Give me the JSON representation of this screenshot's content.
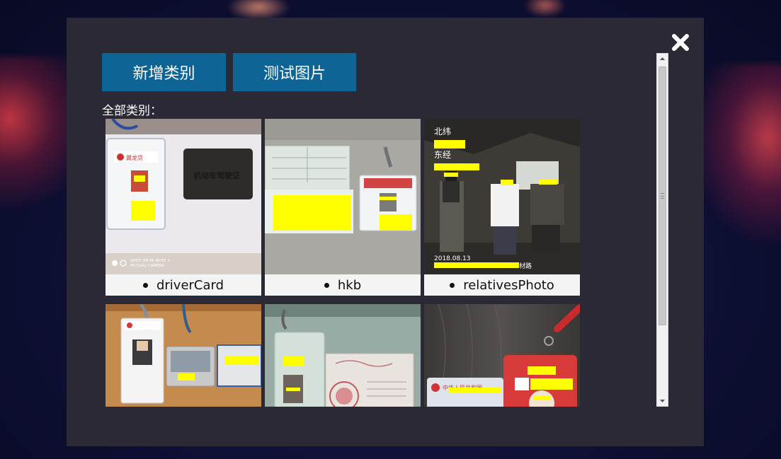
{
  "modal": {
    "buttons": {
      "add_category": "新增类别",
      "test_image": "测试图片"
    },
    "section_label": "全部类别：",
    "categories": [
      {
        "name": "driverCard"
      },
      {
        "name": "hkb"
      },
      {
        "name": "relativesPhoto"
      },
      {
        "name": ""
      },
      {
        "name": ""
      },
      {
        "name": ""
      }
    ],
    "photo_text": {
      "driver_watermark_1": "SHOT ON MI NOTE 3",
      "driver_watermark_2": "MI DUAL CAMERA",
      "license_text": "机动车驾驶证",
      "relatives_lat_label": "北纬",
      "relatives_lon_label": "东经",
      "relatives_date": "2018.08.13",
      "relatives_road": "材路",
      "badge_brand": "翼龙贷",
      "idcard_title": "中华人民共和国"
    }
  },
  "colors": {
    "button_bg": "#0e6495",
    "modal_bg": "#2a2935",
    "redaction": "#ffff00"
  },
  "icons": {
    "close": "close-icon",
    "scroll_up": "scroll-up-arrow-icon",
    "scroll_down": "scroll-down-arrow-icon"
  }
}
